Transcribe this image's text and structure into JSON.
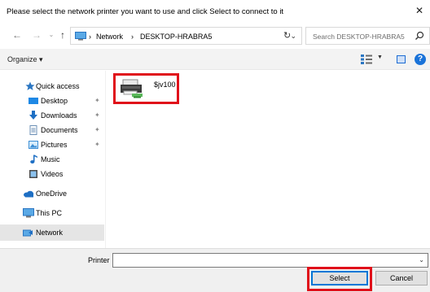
{
  "window": {
    "title": "Please select the network printer you want to use and click Select to connect to it"
  },
  "navigation": {
    "breadcrumb": [
      "Network",
      "DESKTOP-HRABRA5"
    ],
    "search_placeholder": "Search DESKTOP-HRABRA5"
  },
  "toolbar": {
    "organize_label": "Organize ▾"
  },
  "sidebar": {
    "items": [
      {
        "label": "Quick access",
        "icon": "star-icon",
        "pinned": false
      },
      {
        "label": "Desktop",
        "icon": "desktop-folder-icon",
        "pinned": true
      },
      {
        "label": "Downloads",
        "icon": "download-arrow-icon",
        "pinned": true
      },
      {
        "label": "Documents",
        "icon": "documents-icon",
        "pinned": true
      },
      {
        "label": "Pictures",
        "icon": "pictures-icon",
        "pinned": true
      },
      {
        "label": "Music",
        "icon": "music-note-icon",
        "pinned": false
      },
      {
        "label": "Videos",
        "icon": "videos-icon",
        "pinned": false
      },
      {
        "label": "OneDrive",
        "icon": "cloud-icon",
        "pinned": false
      },
      {
        "label": "This PC",
        "icon": "computer-icon",
        "pinned": false
      },
      {
        "label": "Network",
        "icon": "network-icon",
        "pinned": false,
        "selected": true
      }
    ]
  },
  "files": [
    {
      "name": "$jv100",
      "icon": "printer-icon",
      "highlighted": true
    }
  ],
  "footer": {
    "printer_label": "Printer",
    "printer_value": "",
    "select_label": "Select",
    "cancel_label": "Cancel"
  },
  "colors": {
    "highlight_border": "#e0101a",
    "accent": "#0078d7"
  }
}
